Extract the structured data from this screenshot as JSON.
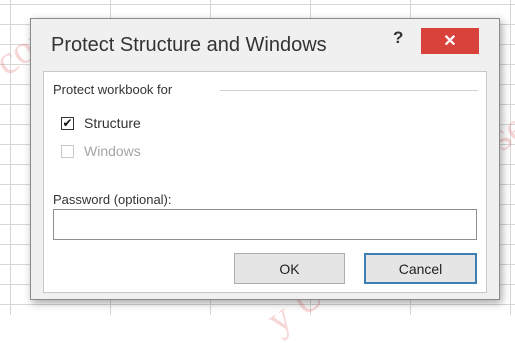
{
  "dialog": {
    "title": "Protect Structure and Windows",
    "help_label": "?",
    "close_label": "✕"
  },
  "protect_group": {
    "label": "Protect workbook for",
    "structure": {
      "label": "Structure",
      "checked": true,
      "mark": "✔"
    },
    "windows": {
      "label": "Windows",
      "checked": false,
      "enabled": false
    }
  },
  "password": {
    "label": "Password (optional):",
    "value": ""
  },
  "buttons": {
    "ok_label": "OK",
    "cancel_label": "Cancel"
  },
  "watermarks": [
    "copy",
    "Universe",
    "y Universe"
  ],
  "colors": {
    "close_button": "#d9413b",
    "default_button_border": "#3c7fb1"
  }
}
